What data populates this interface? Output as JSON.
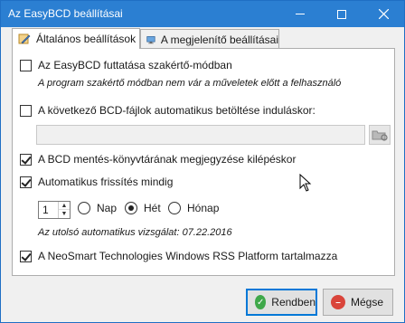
{
  "window": {
    "title": "Az EasyBCD beállításai"
  },
  "tabs": [
    {
      "label": "Általános beállítások",
      "icon": "settings-pencil-icon",
      "active": true
    },
    {
      "label": "A megjelenítő beállításai",
      "icon": "monitor-icon",
      "active": false
    }
  ],
  "options": {
    "expert_mode": {
      "label": "Az EasyBCD futtatása szakértő-módban",
      "checked": false,
      "hint": "A program szakértő módban nem vár a műveletek előtt a felhasználó"
    },
    "auto_load": {
      "label": "A következő BCD-fájlok automatikus betöltése induláskor:",
      "checked": false,
      "path_value": ""
    },
    "remember_backup": {
      "label": "A BCD mentés-könyvtárának megjegyzése kilépéskor",
      "checked": true
    },
    "auto_update": {
      "label": "Automatikus frissítés mindig",
      "checked": true
    },
    "interval": {
      "value": "1",
      "units": [
        "Nap",
        "Hét",
        "Hónap"
      ],
      "selected": "Hét"
    },
    "last_check": "Az utolsó automatikus vizsgálat: 07.22.2016",
    "rss": {
      "label": "A NeoSmart Technologies Windows RSS Platform tartalmazza",
      "checked": true
    }
  },
  "buttons": {
    "ok": "Rendben",
    "cancel": "Mégse"
  },
  "colors": {
    "titlebar": "#2b7fd2",
    "ok_icon": "#3fa84a",
    "cancel_icon": "#d9443a"
  }
}
